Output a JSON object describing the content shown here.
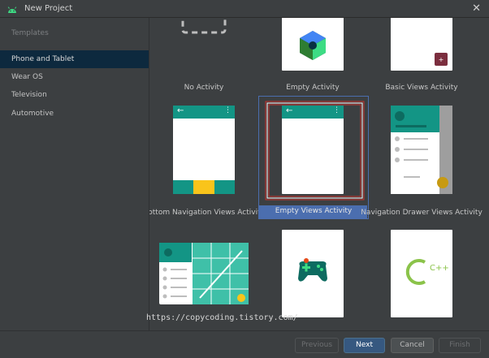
{
  "window": {
    "title": "New Project",
    "close_glyph": "✕"
  },
  "sidebar": {
    "section_label": "Templates",
    "items": [
      {
        "label": "Phone and Tablet",
        "selected": true
      },
      {
        "label": "Wear OS",
        "selected": false
      },
      {
        "label": "Television",
        "selected": false
      },
      {
        "label": "Automotive",
        "selected": false
      }
    ]
  },
  "templates": [
    {
      "label": "No Activity",
      "icon": "dashed-square-icon"
    },
    {
      "label": "Empty Activity",
      "icon": "compose-cube-icon"
    },
    {
      "label": "Basic Views Activity",
      "icon": "fab-icon"
    },
    {
      "label": "Bottom Navigation Views Activity",
      "icon": "bottom-nav-icon"
    },
    {
      "label": "Empty Views Activity",
      "icon": "appbar-icon",
      "selected": true
    },
    {
      "label": "Navigation Drawer Views Activity",
      "icon": "drawer-icon"
    },
    {
      "label": "",
      "icon": "responsive-grid-icon"
    },
    {
      "label": "",
      "icon": "game-controller-icon"
    },
    {
      "label": "",
      "icon": "cpp-icon",
      "glyph": "C++"
    }
  ],
  "watermark": "https://copycoding.tistory.com/",
  "footer": {
    "previous": "Previous",
    "next": "Next",
    "cancel": "Cancel",
    "finish": "Finish"
  },
  "colors": {
    "background": "#3c3f41",
    "selection": "#4b6eaf",
    "teal": "#139585",
    "amber": "#f9c41b",
    "cpp_green": "#8bc34a"
  }
}
